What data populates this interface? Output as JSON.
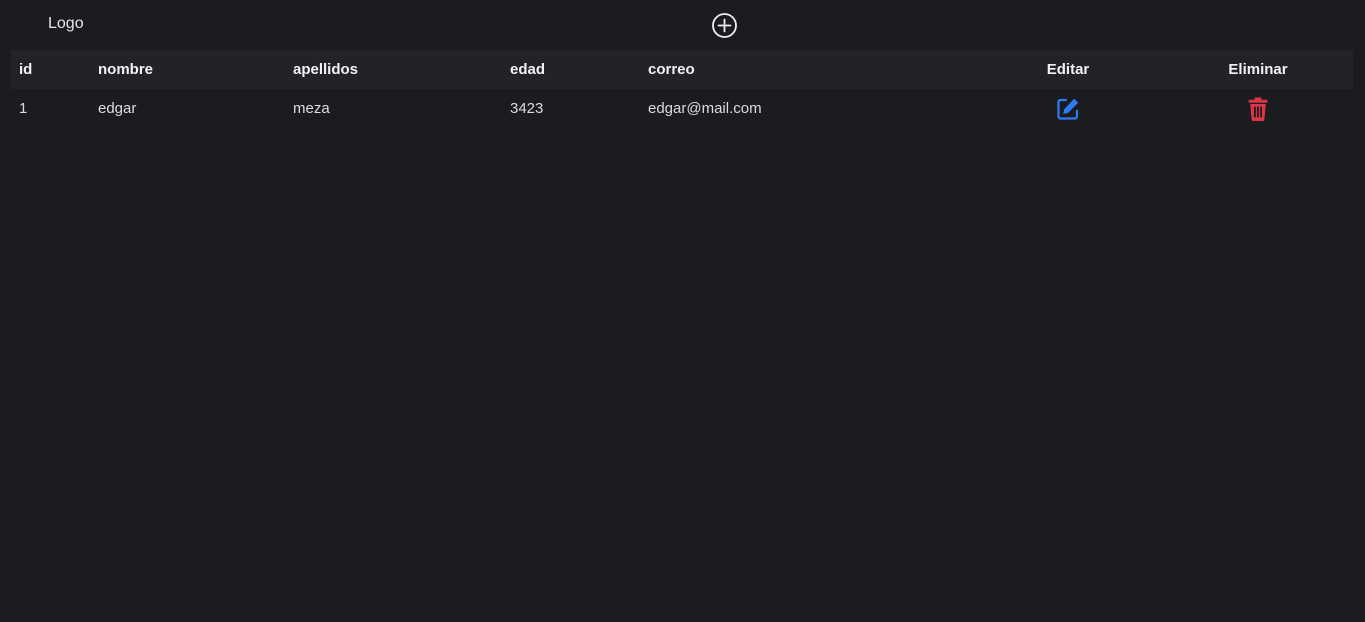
{
  "navbar": {
    "logo": "Logo",
    "add_icon": "plus-circle-icon"
  },
  "table": {
    "headers": {
      "id": "id",
      "nombre": "nombre",
      "apellidos": "apellidos",
      "edad": "edad",
      "correo": "correo",
      "editar": "Editar",
      "eliminar": "Eliminar"
    },
    "rows": [
      {
        "id": "1",
        "nombre": "edgar",
        "apellidos": "meza",
        "edad": "3423",
        "correo": "edgar@mail.com",
        "edit_icon": "edit-icon",
        "delete_icon": "trash-icon"
      }
    ]
  },
  "colors": {
    "background": "#1b1c1f",
    "header_row": "#212327",
    "edit_accent": "#2d7cf6",
    "delete_accent": "#dc3545"
  }
}
